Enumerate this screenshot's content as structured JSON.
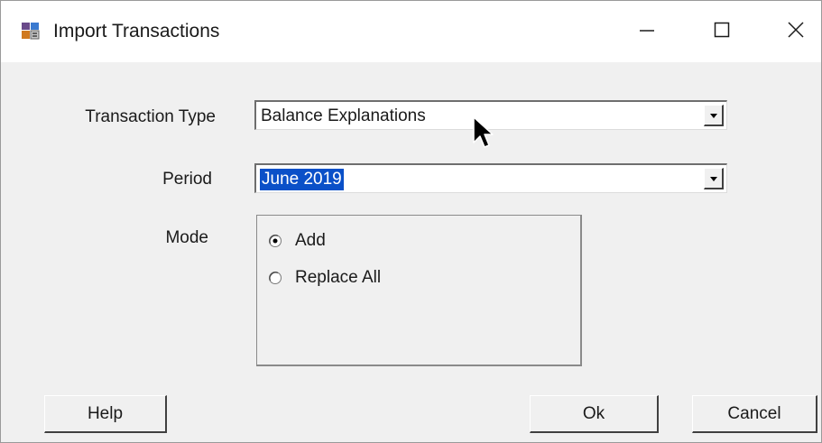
{
  "window": {
    "title": "Import Transactions",
    "icon": "import-app-icon",
    "controls": {
      "minimize_icon": "minimize-icon",
      "maximize_icon": "maximize-icon",
      "close_icon": "close-icon"
    }
  },
  "form": {
    "transaction_type": {
      "label": "Transaction Type",
      "value": "Balance Explanations"
    },
    "period": {
      "label": "Period",
      "value": "June 2019"
    },
    "mode": {
      "label": "Mode",
      "options": [
        {
          "label": "Add",
          "selected": true
        },
        {
          "label": "Replace All",
          "selected": false
        }
      ]
    }
  },
  "buttons": {
    "help": "Help",
    "ok": "Ok",
    "cancel": "Cancel"
  },
  "colors": {
    "selection": "#0a50c8",
    "face": "#f0f0f0",
    "titlebar": "#ffffff"
  }
}
